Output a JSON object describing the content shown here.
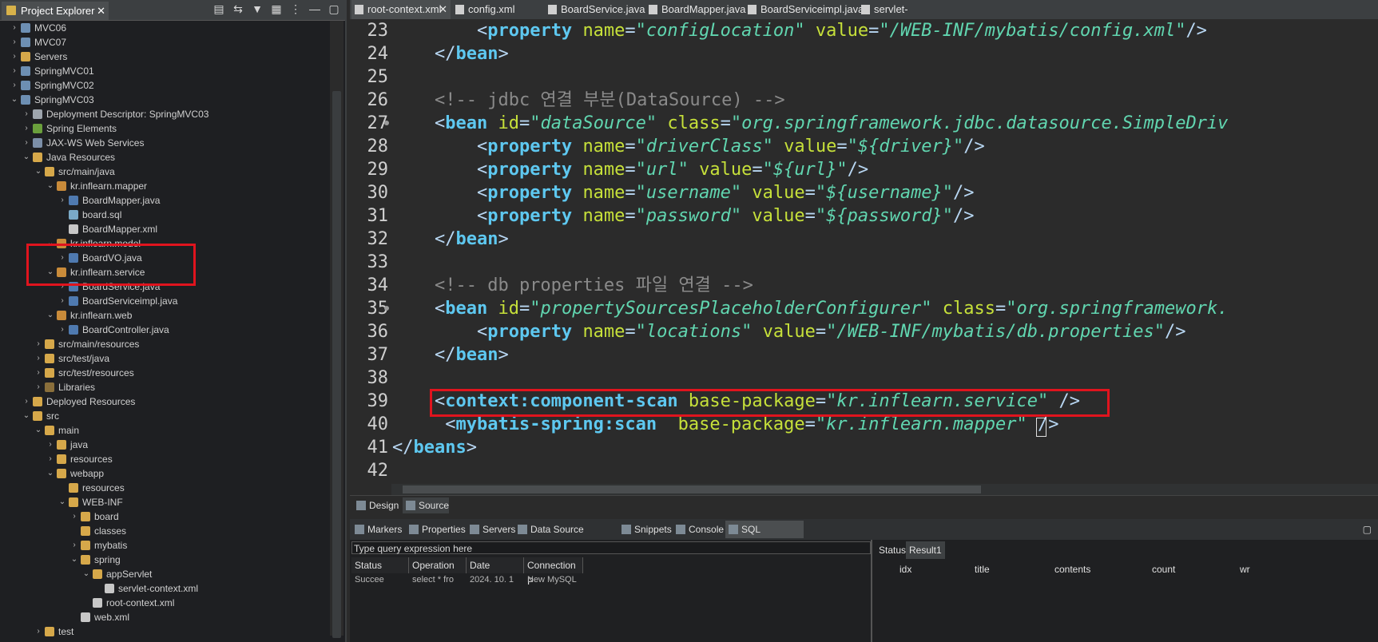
{
  "explorer": {
    "tab_label": "Project Explorer",
    "close": "✕",
    "tree": [
      {
        "label": "MVC06",
        "depth": 0,
        "arrow": "›",
        "icon": "proj"
      },
      {
        "label": "MVC07",
        "depth": 0,
        "arrow": "›",
        "icon": "proj"
      },
      {
        "label": "Servers",
        "depth": 0,
        "arrow": "›",
        "icon": "folder"
      },
      {
        "label": "SpringMVC01",
        "depth": 0,
        "arrow": "›",
        "icon": "proj"
      },
      {
        "label": "SpringMVC02",
        "depth": 0,
        "arrow": "›",
        "icon": "proj"
      },
      {
        "label": "SpringMVC03",
        "depth": 0,
        "arrow": "⌄",
        "icon": "proj"
      },
      {
        "label": "Deployment Descriptor: SpringMVC03",
        "depth": 1,
        "arrow": "›",
        "icon": "dd"
      },
      {
        "label": "Spring Elements",
        "depth": 1,
        "arrow": "›",
        "icon": "spring"
      },
      {
        "label": "JAX-WS Web Services",
        "depth": 1,
        "arrow": "›",
        "icon": "ws"
      },
      {
        "label": "Java Resources",
        "depth": 1,
        "arrow": "⌄",
        "icon": "folder"
      },
      {
        "label": "src/main/java",
        "depth": 2,
        "arrow": "⌄",
        "icon": "folder"
      },
      {
        "label": "kr.inflearn.mapper",
        "depth": 3,
        "arrow": "⌄",
        "icon": "pkg"
      },
      {
        "label": "BoardMapper.java",
        "depth": 4,
        "arrow": "›",
        "icon": "java"
      },
      {
        "label": "board.sql",
        "depth": 4,
        "arrow": "",
        "icon": "sql"
      },
      {
        "label": "BoardMapper.xml",
        "depth": 4,
        "arrow": "",
        "icon": "xml"
      },
      {
        "label": "kr.inflearn.model",
        "depth": 3,
        "arrow": "⌄",
        "icon": "pkg"
      },
      {
        "label": "BoardVO.java",
        "depth": 4,
        "arrow": "›",
        "icon": "java"
      },
      {
        "label": "kr.inflearn.service",
        "depth": 3,
        "arrow": "⌄",
        "icon": "pkg"
      },
      {
        "label": "BoardService.java",
        "depth": 4,
        "arrow": "›",
        "icon": "java"
      },
      {
        "label": "BoardServiceimpl.java",
        "depth": 4,
        "arrow": "›",
        "icon": "java"
      },
      {
        "label": "kr.inflearn.web",
        "depth": 3,
        "arrow": "⌄",
        "icon": "pkg"
      },
      {
        "label": "BoardController.java",
        "depth": 4,
        "arrow": "›",
        "icon": "java"
      },
      {
        "label": "src/main/resources",
        "depth": 2,
        "arrow": "›",
        "icon": "folder"
      },
      {
        "label": "src/test/java",
        "depth": 2,
        "arrow": "›",
        "icon": "folder"
      },
      {
        "label": "src/test/resources",
        "depth": 2,
        "arrow": "›",
        "icon": "folder"
      },
      {
        "label": "Libraries",
        "depth": 2,
        "arrow": "›",
        "icon": "lib"
      },
      {
        "label": "Deployed Resources",
        "depth": 1,
        "arrow": "›",
        "icon": "folder"
      },
      {
        "label": "src",
        "depth": 1,
        "arrow": "⌄",
        "icon": "folder"
      },
      {
        "label": "main",
        "depth": 2,
        "arrow": "⌄",
        "icon": "folder"
      },
      {
        "label": "java",
        "depth": 3,
        "arrow": "›",
        "icon": "folder"
      },
      {
        "label": "resources",
        "depth": 3,
        "arrow": "›",
        "icon": "folder"
      },
      {
        "label": "webapp",
        "depth": 3,
        "arrow": "⌄",
        "icon": "folder"
      },
      {
        "label": "resources",
        "depth": 4,
        "arrow": "",
        "icon": "folder"
      },
      {
        "label": "WEB-INF",
        "depth": 4,
        "arrow": "⌄",
        "icon": "folder"
      },
      {
        "label": "board",
        "depth": 5,
        "arrow": "›",
        "icon": "folder"
      },
      {
        "label": "classes",
        "depth": 5,
        "arrow": "",
        "icon": "folder"
      },
      {
        "label": "mybatis",
        "depth": 5,
        "arrow": "›",
        "icon": "folder"
      },
      {
        "label": "spring",
        "depth": 5,
        "arrow": "⌄",
        "icon": "folder"
      },
      {
        "label": "appServlet",
        "depth": 6,
        "arrow": "⌄",
        "icon": "folder"
      },
      {
        "label": "servlet-context.xml",
        "depth": 7,
        "arrow": "",
        "icon": "xml"
      },
      {
        "label": "root-context.xml",
        "depth": 6,
        "arrow": "",
        "icon": "xml"
      },
      {
        "label": "web.xml",
        "depth": 5,
        "arrow": "",
        "icon": "xml"
      },
      {
        "label": "test",
        "depth": 2,
        "arrow": "›",
        "icon": "folder"
      }
    ]
  },
  "editor": {
    "tabs": [
      {
        "label": "root-context.xml",
        "close": "✕"
      },
      {
        "label": "config.xml"
      },
      {
        "label": "BoardService.java"
      },
      {
        "label": "BoardMapper.java"
      },
      {
        "label": "BoardServiceimpl.java"
      },
      {
        "label": "servlet-context.xml"
      }
    ],
    "lines": [
      {
        "num": "23",
        "parts": [
          [
            "t",
            "        <"
          ],
          [
            "e",
            "property"
          ],
          [
            "t",
            " "
          ],
          [
            "a",
            "name"
          ],
          [
            "t",
            "="
          ],
          [
            "v",
            "\"configLocation\""
          ],
          [
            "t",
            " "
          ],
          [
            "a",
            "value"
          ],
          [
            "t",
            "="
          ],
          [
            "v",
            "\"/WEB-INF/mybatis/config.xml\""
          ],
          [
            "t",
            "/>"
          ]
        ]
      },
      {
        "num": "24",
        "parts": [
          [
            "t",
            "    </"
          ],
          [
            "e",
            "bean"
          ],
          [
            "t",
            ">"
          ]
        ]
      },
      {
        "num": "25",
        "parts": []
      },
      {
        "num": "26",
        "parts": [
          [
            "c",
            "    <!-- jdbc 연결 부분(DataSource) -->"
          ]
        ]
      },
      {
        "num": "27",
        "parts": [
          [
            "t",
            "    <"
          ],
          [
            "e",
            "bean"
          ],
          [
            "t",
            " "
          ],
          [
            "a",
            "id"
          ],
          [
            "t",
            "="
          ],
          [
            "v",
            "\"dataSource\""
          ],
          [
            "t",
            " "
          ],
          [
            "a",
            "class"
          ],
          [
            "t",
            "="
          ],
          [
            "v",
            "\"org.springframework.jdbc.datasource.SimpleDriv"
          ]
        ]
      },
      {
        "num": "28",
        "parts": [
          [
            "t",
            "        <"
          ],
          [
            "e",
            "property"
          ],
          [
            "t",
            " "
          ],
          [
            "a",
            "name"
          ],
          [
            "t",
            "="
          ],
          [
            "v",
            "\"driverClass\""
          ],
          [
            "t",
            " "
          ],
          [
            "a",
            "value"
          ],
          [
            "t",
            "="
          ],
          [
            "v",
            "\"${driver}\""
          ],
          [
            "t",
            "/>"
          ]
        ]
      },
      {
        "num": "29",
        "parts": [
          [
            "t",
            "        <"
          ],
          [
            "e",
            "property"
          ],
          [
            "t",
            " "
          ],
          [
            "a",
            "name"
          ],
          [
            "t",
            "="
          ],
          [
            "v",
            "\"url\""
          ],
          [
            "t",
            " "
          ],
          [
            "a",
            "value"
          ],
          [
            "t",
            "="
          ],
          [
            "v",
            "\"${url}\""
          ],
          [
            "t",
            "/>"
          ]
        ]
      },
      {
        "num": "30",
        "parts": [
          [
            "t",
            "        <"
          ],
          [
            "e",
            "property"
          ],
          [
            "t",
            " "
          ],
          [
            "a",
            "name"
          ],
          [
            "t",
            "="
          ],
          [
            "v",
            "\"username\""
          ],
          [
            "t",
            " "
          ],
          [
            "a",
            "value"
          ],
          [
            "t",
            "="
          ],
          [
            "v",
            "\"${username}\""
          ],
          [
            "t",
            "/>"
          ]
        ]
      },
      {
        "num": "31",
        "parts": [
          [
            "t",
            "        <"
          ],
          [
            "e",
            "property"
          ],
          [
            "t",
            " "
          ],
          [
            "a",
            "name"
          ],
          [
            "t",
            "="
          ],
          [
            "v",
            "\"password\""
          ],
          [
            "t",
            " "
          ],
          [
            "a",
            "value"
          ],
          [
            "t",
            "="
          ],
          [
            "v",
            "\"${password}\""
          ],
          [
            "t",
            "/>"
          ]
        ]
      },
      {
        "num": "32",
        "parts": [
          [
            "t",
            "    </"
          ],
          [
            "e",
            "bean"
          ],
          [
            "t",
            ">"
          ]
        ]
      },
      {
        "num": "33",
        "parts": []
      },
      {
        "num": "34",
        "parts": [
          [
            "c",
            "    <!-- db properties 파일 연결 -->"
          ]
        ]
      },
      {
        "num": "35",
        "parts": [
          [
            "t",
            "    <"
          ],
          [
            "e",
            "bean"
          ],
          [
            "t",
            " "
          ],
          [
            "a",
            "id"
          ],
          [
            "t",
            "="
          ],
          [
            "v",
            "\"propertySourcesPlaceholderConfigurer\""
          ],
          [
            "t",
            " "
          ],
          [
            "a",
            "class"
          ],
          [
            "t",
            "="
          ],
          [
            "v",
            "\"org.springframework."
          ]
        ]
      },
      {
        "num": "36",
        "parts": [
          [
            "t",
            "        <"
          ],
          [
            "e",
            "property"
          ],
          [
            "t",
            " "
          ],
          [
            "a",
            "name"
          ],
          [
            "t",
            "="
          ],
          [
            "v",
            "\"locations\""
          ],
          [
            "t",
            " "
          ],
          [
            "a",
            "value"
          ],
          [
            "t",
            "="
          ],
          [
            "v",
            "\"/WEB-INF/mybatis/db.properties\""
          ],
          [
            "t",
            "/>"
          ]
        ]
      },
      {
        "num": "37",
        "parts": [
          [
            "t",
            "    </"
          ],
          [
            "e",
            "bean"
          ],
          [
            "t",
            ">"
          ]
        ]
      },
      {
        "num": "38",
        "parts": []
      },
      {
        "num": "39",
        "parts": [
          [
            "t",
            "    <"
          ],
          [
            "e",
            "context:component-scan"
          ],
          [
            "t",
            " "
          ],
          [
            "a",
            "base-package"
          ],
          [
            "t",
            "="
          ],
          [
            "v",
            "\"kr.inflearn.service\""
          ],
          [
            "t",
            " />"
          ]
        ]
      },
      {
        "num": "40",
        "parts": [
          [
            "t",
            "     <"
          ],
          [
            "e",
            "mybatis-spring:scan"
          ],
          [
            "t",
            "  "
          ],
          [
            "a",
            "base-package"
          ],
          [
            "t",
            "="
          ],
          [
            "v",
            "\"kr.inflearn.mapper\""
          ],
          [
            "t",
            " />"
          ]
        ]
      },
      {
        "num": "41",
        "parts": [
          [
            "t",
            "</"
          ],
          [
            "e",
            "beans"
          ],
          [
            "t",
            ">"
          ]
        ]
      },
      {
        "num": "42",
        "parts": []
      }
    ],
    "design_tab": "Design",
    "source_tab": "Source"
  },
  "bottom": {
    "tabs": [
      {
        "label": "Markers"
      },
      {
        "label": "Properties"
      },
      {
        "label": "Servers"
      },
      {
        "label": "Data Source Explorer"
      },
      {
        "label": "Snippets"
      },
      {
        "label": "Console"
      },
      {
        "label": "SQL Results",
        "close": "✕"
      }
    ],
    "query_placeholder": "Type query expression here",
    "columns": [
      "Status",
      "Operation",
      "Date",
      "Connection P"
    ],
    "row": [
      "Succee",
      "select * fro",
      "2024. 10. 1",
      "New MySQL"
    ],
    "result_tabs": [
      "Status",
      "Result1"
    ],
    "result_columns": [
      "idx",
      "title",
      "contents",
      "count",
      "wr"
    ]
  }
}
